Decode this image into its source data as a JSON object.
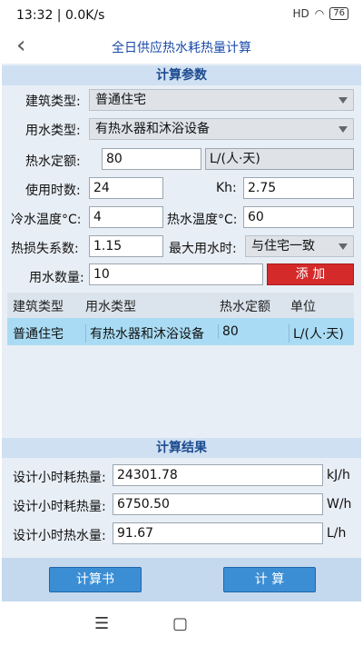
{
  "status": {
    "time": "13:32 | 0.0K/s",
    "battery": "76",
    "signal": "HD"
  },
  "header": {
    "title": "全日供应热水耗热量计算"
  },
  "params": {
    "section_title": "计算参数",
    "building_type_label": "建筑类型:",
    "building_type_value": "普通住宅",
    "water_type_label": "用水类型:",
    "water_type_value": "有热水器和沐浴设备",
    "quota_label": "热水定额:",
    "quota_value": "80",
    "quota_unit": "L/(人·天)",
    "hours_label": "使用时数:",
    "hours_value": "24",
    "kh_label": "Kh:",
    "kh_value": "2.75",
    "cold_temp_label": "冷水温度°C:",
    "cold_temp_value": "4",
    "hot_temp_label": "热水温度°C:",
    "hot_temp_value": "60",
    "loss_label": "热损失系数:",
    "loss_value": "1.15",
    "max_time_label": "最大用水时:",
    "max_time_value": "与住宅一致",
    "count_label": "用水数量:",
    "count_value": "10",
    "add_label": "添 加"
  },
  "table": {
    "headers": [
      "建筑类型",
      "用水类型",
      "热水定额",
      "单位"
    ],
    "rows": [
      [
        "普通住宅",
        "有热水器和沐浴设备",
        "80",
        "L/(人·天)"
      ]
    ]
  },
  "results": {
    "section_title": "计算结果",
    "rows": [
      {
        "label": "设计小时耗热量:",
        "value": "24301.78",
        "unit": "kJ/h"
      },
      {
        "label": "设计小时耗热量:",
        "value": "6750.50",
        "unit": "W/h"
      },
      {
        "label": "设计小时热水量:",
        "value": "91.67",
        "unit": "L/h"
      }
    ]
  },
  "buttons": {
    "report": "计算书",
    "calculate": "计 算"
  },
  "nav": {
    "menu": "☰",
    "home": "▢"
  }
}
